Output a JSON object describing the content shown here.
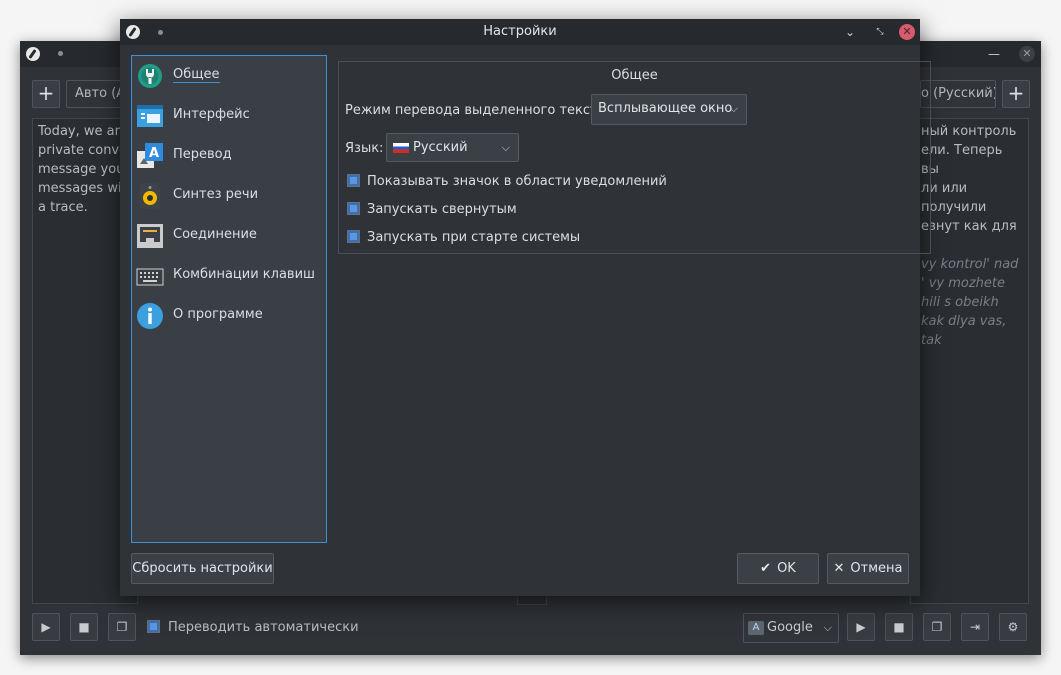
{
  "main_window": {
    "add_left_label": "+",
    "add_right_label": "+",
    "source_lang": "Авто (А",
    "target_lang": "о (Русский)",
    "source_text": "Today, we are private conve message you messages will a trace.",
    "source_lines": [
      "Today, we are",
      "private conve",
      "message you",
      "messages will",
      "a trace."
    ],
    "result_lines": [
      "ный контроль",
      "ели. Теперь вы",
      "ли или получили",
      "езнут как для"
    ],
    "translit_lines": [
      "vy kontrol' nad",
      "' vy mozhete",
      "hili s obeikh",
      "kak dlya vas, tak"
    ],
    "auto_translate_label": "Переводить автоматически",
    "engine": "Google",
    "engine_icon": "translate-icon",
    "bottom_icons": [
      "play-icon",
      "stop-icon",
      "copy-icon",
      "copy-all-icon",
      "export-icon",
      "settings-icon"
    ]
  },
  "dialog": {
    "title": "Настройки",
    "sidebar": [
      {
        "label": "Общее",
        "icon": "general-wrench-icon",
        "active": true
      },
      {
        "label": "Интерфейс",
        "icon": "interface-window-icon",
        "active": false
      },
      {
        "label": "Перевод",
        "icon": "translation-icon",
        "active": false
      },
      {
        "label": "Синтез речи",
        "icon": "speaker-icon",
        "active": false
      },
      {
        "label": "Соединение",
        "icon": "network-icon",
        "active": false
      },
      {
        "label": "Комбинации клавиш",
        "icon": "keyboard-icon",
        "active": false
      },
      {
        "label": "О программе",
        "icon": "info-icon",
        "active": false
      }
    ],
    "group_title": "Общее",
    "popup_mode_label": "Режим перевода выделенного текста:",
    "popup_mode_value": "Всплывающее окно",
    "language_label": "Язык:",
    "language_value": "Русский",
    "checkboxes": [
      {
        "label": "Показывать значок в области уведомлений",
        "checked": true
      },
      {
        "label": "Запускать свернутым",
        "checked": true
      },
      {
        "label": "Запускать при старте системы",
        "checked": true
      }
    ],
    "reset_label": "Сбросить настройки",
    "ok_label": "OK",
    "cancel_label": "Отмена"
  },
  "colors": {
    "accent": "#3d8fd6",
    "window_bg": "#2f3237",
    "titlebar_bg": "#26292d",
    "close_button": "#d95a6a"
  }
}
